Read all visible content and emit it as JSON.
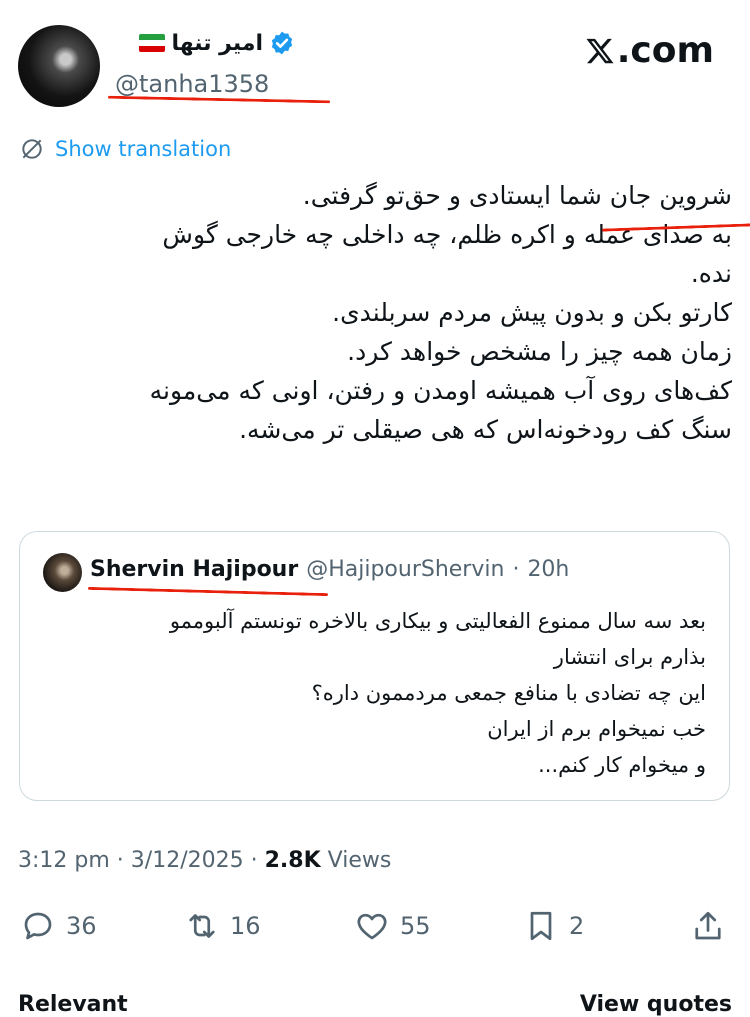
{
  "site": {
    "logo_text": ".com"
  },
  "author": {
    "display_name": "امیر تنها",
    "handle": "@tanha1358",
    "flag_colors": [
      "#239f40",
      "#ffffff",
      "#da0000"
    ],
    "verified_color": "#1d9bf0"
  },
  "translate": {
    "label": "Show translation",
    "icon": "translate-icon"
  },
  "tweet": {
    "lines": [
      "شروین جان شما ایستادی و حق‌تو گرفتی.",
      "به صدای عمله و اکره ظلم، چه داخلی چه خارجی گوش",
      "نده.",
      "کارتو بکن و بدون پیش مردم سربلندی.",
      "زمان همه چیز را مشخص خواهد کرد.",
      "کف‌های روی آب همیشه اومدن و رفتن، اونی که می‌مونه",
      "سنگ کف رودخونه‌اس که هی صیقلی تر می‌شه."
    ]
  },
  "quote": {
    "name": "Shervin Hajipour",
    "handle": "@HajipourShervin",
    "separator": "·",
    "time": "20h",
    "lines": [
      "بعد سه سال ممنوع الفعالیتی و بیکاری بالاخره تونستم آلبوممو",
      "بذارم برای انتشار",
      "این چه تضادی با منافع جمعی مردممون داره؟",
      "خب نمیخوام برم از ایران",
      "و میخوام کار کنم..."
    ]
  },
  "meta": {
    "time": "3:12 pm",
    "sep1": "·",
    "date": "3/12/2025",
    "sep2": "·",
    "views_count": "2.8K",
    "views_label": "Views"
  },
  "actions": {
    "replies": "36",
    "reposts": "16",
    "likes": "55",
    "bookmarks": "2"
  },
  "bottom": {
    "relevant": "Relevant",
    "view_quotes": "View quotes"
  },
  "colors": {
    "accent": "#1d9bf0",
    "muted": "#536471",
    "annotation": "#e8200c"
  }
}
